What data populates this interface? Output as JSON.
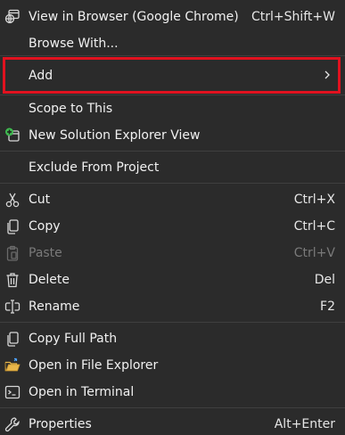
{
  "menu": {
    "items": [
      {
        "label": "View in Browser (Google Chrome)",
        "shortcut": "Ctrl+Shift+W",
        "icon": "browser-view-icon"
      },
      {
        "label": "Browse With...",
        "shortcut": "",
        "icon": ""
      },
      {
        "label": "Add",
        "shortcut": "",
        "icon": "",
        "has_submenu": true
      },
      {
        "label": "Scope to This",
        "shortcut": "",
        "icon": ""
      },
      {
        "label": "New Solution Explorer View",
        "shortcut": "",
        "icon": "new-solution-view-icon"
      },
      {
        "label": "Exclude From Project",
        "shortcut": "",
        "icon": ""
      },
      {
        "label": "Cut",
        "shortcut": "Ctrl+X",
        "icon": "scissors-icon"
      },
      {
        "label": "Copy",
        "shortcut": "Ctrl+C",
        "icon": "copy-icon"
      },
      {
        "label": "Paste",
        "shortcut": "Ctrl+V",
        "icon": "clipboard-icon",
        "disabled": true
      },
      {
        "label": "Delete",
        "shortcut": "Del",
        "icon": "trash-icon"
      },
      {
        "label": "Rename",
        "shortcut": "F2",
        "icon": "rename-icon"
      },
      {
        "label": "Copy Full Path",
        "shortcut": "",
        "icon": "copy-icon"
      },
      {
        "label": "Open in File Explorer",
        "shortcut": "",
        "icon": "folder-open-icon"
      },
      {
        "label": "Open in Terminal",
        "shortcut": "",
        "icon": "terminal-icon"
      },
      {
        "label": "Properties",
        "shortcut": "Alt+Enter",
        "icon": "wrench-icon"
      }
    ]
  },
  "colors": {
    "background": "#2b2b2b",
    "text": "#f1f1f1",
    "disabled_text": "#7a7a7a",
    "highlight_border": "#e1121f",
    "separator": "#3f3f3f",
    "accent_green": "#3fb950",
    "folder_yellow": "#e8b64a"
  }
}
